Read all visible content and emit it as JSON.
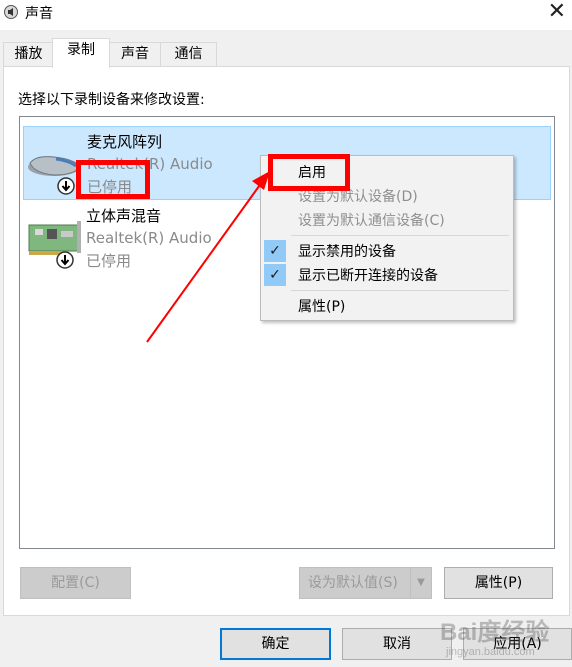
{
  "window": {
    "title": "声音"
  },
  "tabs": [
    {
      "label": "播放"
    },
    {
      "label": "录制"
    },
    {
      "label": "声音"
    },
    {
      "label": "通信"
    }
  ],
  "active_tab": "录制",
  "instruction": "选择以下录制设备来修改设置:",
  "devices": [
    {
      "name": "麦克风阵列",
      "driver": "Realtek(R) Audio",
      "status": "已停用",
      "icon": "microphone-array-icon",
      "selected": true
    },
    {
      "name": "立体声混音",
      "driver": "Realtek(R) Audio",
      "status": "已停用",
      "icon": "sound-card-icon",
      "selected": false
    }
  ],
  "context_menu": {
    "items": [
      {
        "label": "启用",
        "enabled": true,
        "checked": false
      },
      {
        "label": "设置为默认设备(D)",
        "enabled": false,
        "checked": false
      },
      {
        "label": "设置为默认通信设备(C)",
        "enabled": false,
        "checked": false
      },
      {
        "label": "显示禁用的设备",
        "enabled": true,
        "checked": true
      },
      {
        "label": "显示已断开连接的设备",
        "enabled": true,
        "checked": true
      },
      {
        "label": "属性(P)",
        "enabled": true,
        "checked": false
      }
    ]
  },
  "buttons": {
    "configure": "配置(C)",
    "set_default": "设为默认值(S)",
    "properties": "属性(P)",
    "ok": "确定",
    "cancel": "取消",
    "apply": "应用(A)"
  },
  "watermark": {
    "main": "Bai度经验",
    "sub": "jingyan.baidu.com"
  },
  "colors": {
    "selection": "#cce8ff",
    "highlight": "#ff0000",
    "accent": "#0078d7"
  }
}
